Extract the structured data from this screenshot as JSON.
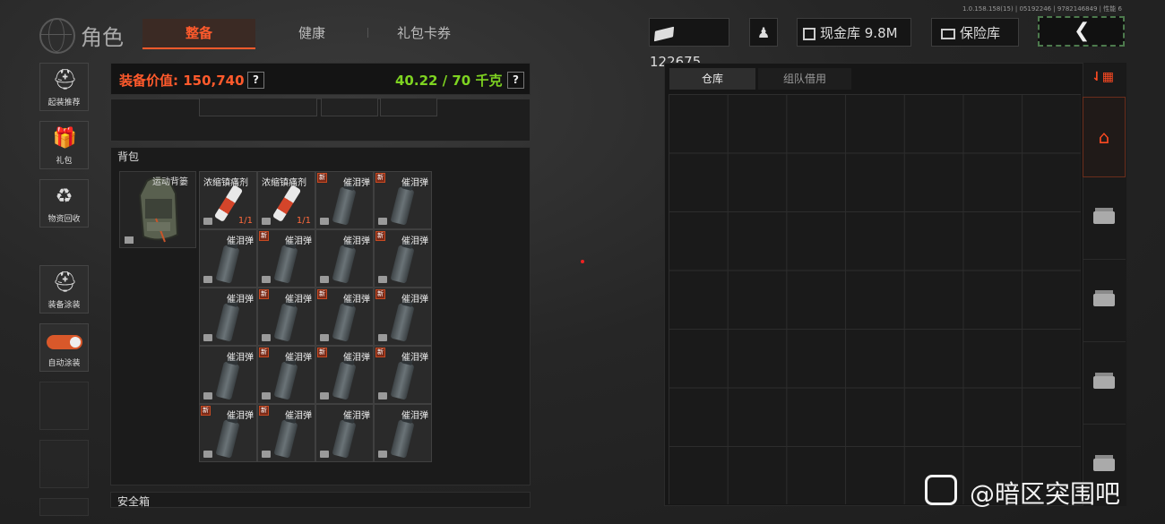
{
  "version": "1.0.158.158(15) | 05192246 | 9782146849 | 性能 6",
  "header": {
    "title": "角色",
    "tabs": [
      "整备",
      "健康",
      "礼包卡券"
    ],
    "cash": "122675",
    "vault_label": "现金库 9.8M",
    "safe_label": "保险库"
  },
  "sidebar": {
    "items": [
      "起装推荐",
      "礼包",
      "物资回收",
      "装备涂装",
      "自动涂装"
    ]
  },
  "equipment": {
    "value_label": "装备价值: 150,740",
    "weight_label": "40.22 / 70 千克",
    "help": "?"
  },
  "backpack": {
    "title": "背包",
    "bag_name": "运动背篓",
    "items": [
      {
        "name": "浓缩镇痛剂",
        "count": "1/1",
        "new": "",
        "kind": "syringe"
      },
      {
        "name": "浓缩镇痛剂",
        "count": "1/1",
        "new": "",
        "kind": "syringe"
      },
      {
        "name": "催泪弹",
        "count": "",
        "new": "新",
        "kind": "canister"
      },
      {
        "name": "催泪弹",
        "count": "",
        "new": "新",
        "kind": "canister"
      },
      {
        "name": "催泪弹",
        "count": "",
        "new": "",
        "kind": "canister"
      },
      {
        "name": "催泪弹",
        "count": "",
        "new": "新",
        "kind": "canister"
      },
      {
        "name": "催泪弹",
        "count": "",
        "new": "",
        "kind": "canister"
      },
      {
        "name": "催泪弹",
        "count": "",
        "new": "新",
        "kind": "canister"
      },
      {
        "name": "催泪弹",
        "count": "",
        "new": "",
        "kind": "canister"
      },
      {
        "name": "催泪弹",
        "count": "",
        "new": "新",
        "kind": "canister"
      },
      {
        "name": "催泪弹",
        "count": "",
        "new": "新",
        "kind": "canister"
      },
      {
        "name": "催泪弹",
        "count": "",
        "new": "新",
        "kind": "canister"
      },
      {
        "name": "催泪弹",
        "count": "",
        "new": "",
        "kind": "canister"
      },
      {
        "name": "催泪弹",
        "count": "",
        "new": "新",
        "kind": "canister"
      },
      {
        "name": "催泪弹",
        "count": "",
        "new": "新",
        "kind": "canister"
      },
      {
        "name": "催泪弹",
        "count": "",
        "new": "新",
        "kind": "canister"
      },
      {
        "name": "催泪弹",
        "count": "",
        "new": "新",
        "kind": "canister"
      },
      {
        "name": "催泪弹",
        "count": "",
        "new": "新",
        "kind": "canister"
      },
      {
        "name": "催泪弹",
        "count": "",
        "new": "",
        "kind": "canister"
      },
      {
        "name": "催泪弹",
        "count": "",
        "new": "",
        "kind": "canister"
      }
    ]
  },
  "safebox": {
    "title": "安全箱"
  },
  "warehouse": {
    "tabs": [
      "仓库",
      "组队借用"
    ]
  },
  "watermark": "@暗区突围吧",
  "colors": {
    "accent": "#ff5a2c",
    "weight": "#7ed321"
  }
}
